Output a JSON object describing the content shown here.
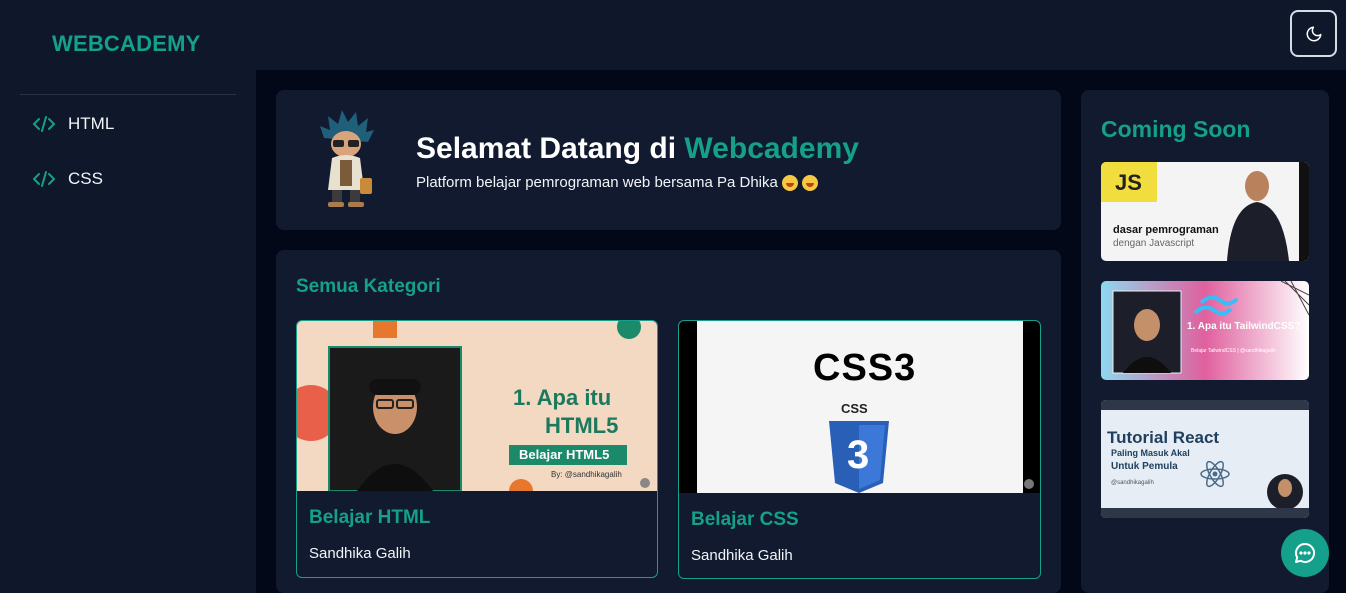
{
  "app": {
    "logo": "WEBCADEMY"
  },
  "header": {
    "theme_toggle_icon": "moon-icon"
  },
  "sidebar": {
    "items": [
      {
        "label": "HTML",
        "icon": "code-icon"
      },
      {
        "label": "CSS",
        "icon": "code-icon"
      }
    ]
  },
  "welcome": {
    "title_prefix": "Selamat Datang di ",
    "title_accent": "Webcademy",
    "subtitle": "Platform belajar pemrograman web bersama Pa Dhika"
  },
  "categories": {
    "heading": "Semua Kategori",
    "courses": [
      {
        "title": "Belajar HTML",
        "author": "Sandhika Galih",
        "thumb": {
          "line1": "1. Apa itu",
          "line2": "HTML5",
          "badge": "Belajar HTML5",
          "by": "By: @sandhikagalih"
        }
      },
      {
        "title": "Belajar CSS",
        "author": "Sandhika Galih",
        "thumb": {
          "big": "CSS3",
          "shield_label": "CSS",
          "shield_number": "3"
        }
      }
    ]
  },
  "coming_soon": {
    "heading": "Coming Soon",
    "items": [
      {
        "badge": "JS",
        "line1": "dasar pemrograman",
        "line2": "dengan Javascript"
      },
      {
        "line1": "1. Apa itu TailwindCSS?",
        "line2": "Belajar TailwindCSS | @sandhikagalih"
      },
      {
        "line1": "Tutorial React",
        "line2": "Paling Masuk Akal",
        "line3": "Untuk Pemula",
        "by": "@sandhikagalih"
      }
    ]
  },
  "colors": {
    "accent": "#14a08a",
    "background": "#0b1120",
    "card": "#111a2e"
  },
  "chat_button_icon": "chat-bubble-icon"
}
